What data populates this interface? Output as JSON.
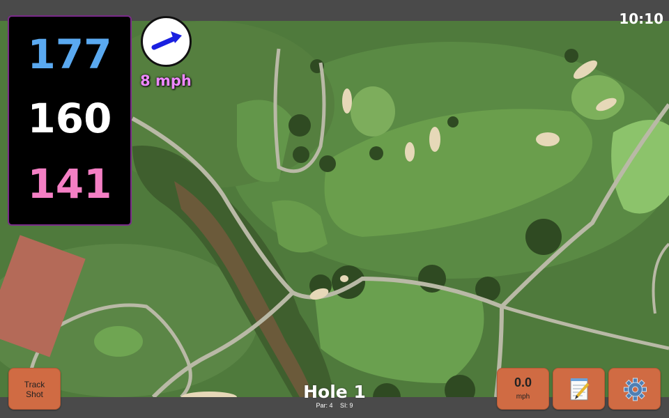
{
  "status_bar": {
    "clock": "10:10"
  },
  "distances": {
    "back": "177",
    "center": "160",
    "front": "141"
  },
  "wind": {
    "speed_label": "8 mph",
    "arrow_icon": "wind-arrow-icon"
  },
  "controls": {
    "track_shot_line1": "Track",
    "track_shot_line2": "Shot",
    "speed_value": "0.0",
    "speed_unit": "mph",
    "notes_icon": "notepad-icon",
    "settings_icon": "gear-icon"
  },
  "hole": {
    "title": "Hole 1",
    "par_label": "Par: 4",
    "si_label": "SI: 9"
  },
  "colors": {
    "accent_button": "#d06b43",
    "back_distance": "#5aa9f0",
    "front_distance": "#f47fc4",
    "wind_text": "#ee88ff"
  }
}
